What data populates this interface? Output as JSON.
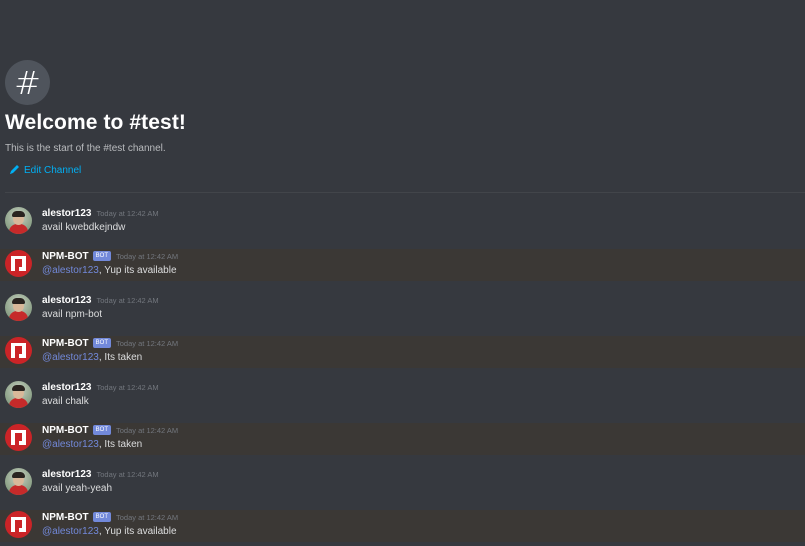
{
  "channel": {
    "hash_symbol": "#",
    "welcome_title": "Welcome to #test!",
    "welcome_subtitle": "This is the start of the #test channel.",
    "edit_label": "Edit Channel"
  },
  "colors": {
    "background": "#36393f",
    "bot_row_highlight": "#3b3835",
    "link": "#00b0f4",
    "mention": "#7289da",
    "bot_tag": "#7289da",
    "npm_red": "#cb2427"
  },
  "messages": [
    {
      "author": "alestor123",
      "is_bot": false,
      "time": "Today at 12:42 AM",
      "text": "avail kwebdkejndw"
    },
    {
      "author": "NPM-BOT",
      "is_bot": true,
      "bot_tag": "BOT",
      "time": "Today at 12:42 AM",
      "mention": "@alestor123",
      "text": ", Yup its available"
    },
    {
      "author": "alestor123",
      "is_bot": false,
      "time": "Today at 12:42 AM",
      "text": "avail npm-bot"
    },
    {
      "author": "NPM-BOT",
      "is_bot": true,
      "bot_tag": "BOT",
      "time": "Today at 12:42 AM",
      "mention": "@alestor123",
      "text": ", Its taken"
    },
    {
      "author": "alestor123",
      "is_bot": false,
      "time": "Today at 12:42 AM",
      "text": "avail chalk"
    },
    {
      "author": "NPM-BOT",
      "is_bot": true,
      "bot_tag": "BOT",
      "time": "Today at 12:42 AM",
      "mention": "@alestor123",
      "text": ", Its taken"
    },
    {
      "author": "alestor123",
      "is_bot": false,
      "time": "Today at 12:42 AM",
      "text": "avail yeah-yeah"
    },
    {
      "author": "NPM-BOT",
      "is_bot": true,
      "bot_tag": "BOT",
      "time": "Today at 12:42 AM",
      "mention": "@alestor123",
      "text": ", Yup its available"
    }
  ]
}
